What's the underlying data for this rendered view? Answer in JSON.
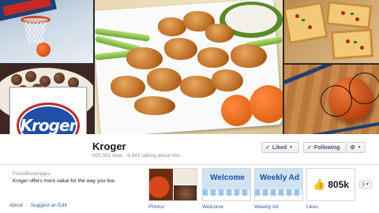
{
  "page": {
    "name": "Kroger",
    "stats": "805,501 likes · 9,841 talking about this",
    "category": "Food/Beverages",
    "description": "Kroger offers more value for the way you live.",
    "logo_text": "Kroger"
  },
  "actions": {
    "liked_label": "Liked",
    "following_label": "Following"
  },
  "links": {
    "about": "About",
    "separator": "·",
    "suggest": "Suggest an Edit"
  },
  "apps": [
    {
      "label": "Photos"
    },
    {
      "label": "Welcome",
      "banner": "Welcome"
    },
    {
      "label": "Weekly Ad",
      "banner": "Weekly Ad"
    },
    {
      "label": "Likes",
      "count": "805k"
    }
  ],
  "more": {
    "count": "3"
  },
  "icons": {
    "check": "check-icon",
    "caret": "caret-down-icon",
    "gear": "gear-icon",
    "thumb": "thumbs-up-icon"
  },
  "colors": {
    "link": "#3b5998",
    "brand_blue": "#1f4fa6",
    "brand_red": "#c0292b"
  }
}
